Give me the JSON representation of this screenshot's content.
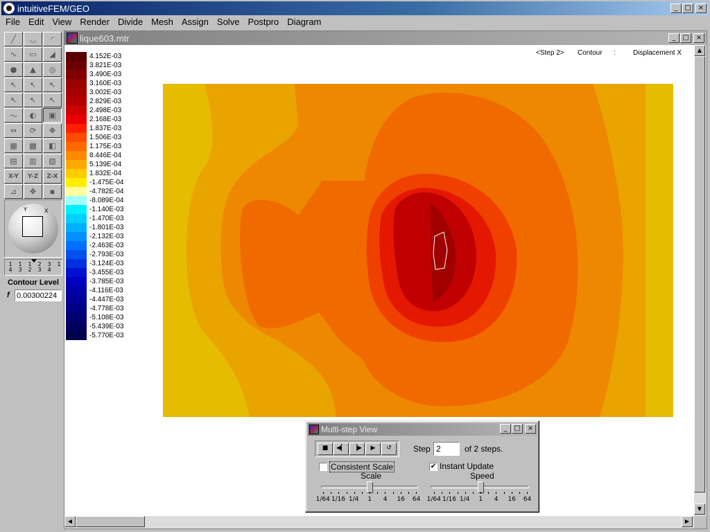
{
  "app": {
    "title": "intuitiveFEM/GEO",
    "menu": [
      "File",
      "Edit",
      "View",
      "Render",
      "Divide",
      "Mesh",
      "Assign",
      "Solve",
      "Postpro",
      "Diagram"
    ]
  },
  "window_buttons": {
    "minimize": "_",
    "maximize": "□",
    "close": "×"
  },
  "toolbar": {
    "tools": [
      {
        "icon": "line-icon",
        "glyph": "╱"
      },
      {
        "icon": "arc-icon",
        "glyph": "◡"
      },
      {
        "icon": "arc3-icon",
        "glyph": "◜"
      },
      {
        "icon": "spline-icon",
        "glyph": "∿"
      },
      {
        "icon": "rectangle-icon",
        "glyph": "▭"
      },
      {
        "icon": "surface-icon",
        "glyph": "◢"
      },
      {
        "icon": "circle-solid-icon",
        "glyph": "●"
      },
      {
        "icon": "cone-icon",
        "glyph": "▲"
      },
      {
        "icon": "torus-icon",
        "glyph": "◎"
      },
      {
        "icon": "select-icon",
        "glyph": "↖"
      },
      {
        "icon": "select-edge-icon",
        "glyph": "↖"
      },
      {
        "icon": "select-face-icon",
        "glyph": "↖"
      },
      {
        "icon": "select-node-icon",
        "glyph": "↖"
      },
      {
        "icon": "select-element-icon",
        "glyph": "↖"
      },
      {
        "icon": "select-volume-icon",
        "glyph": "↖"
      },
      {
        "icon": "curve-icon",
        "glyph": "〜"
      },
      {
        "icon": "sweep-icon",
        "glyph": "◐"
      },
      {
        "icon": "pick-display-icon",
        "glyph": "▣"
      },
      {
        "icon": "move-icon",
        "glyph": "⇔"
      },
      {
        "icon": "rotate-icon",
        "glyph": "⟳"
      },
      {
        "icon": "pan-icon",
        "glyph": "✥"
      },
      {
        "icon": "box-wire-icon",
        "glyph": "▦"
      },
      {
        "icon": "box-solid-icon",
        "glyph": "▩"
      },
      {
        "icon": "box-shaded-icon",
        "glyph": "◧"
      },
      {
        "icon": "mesh-icon",
        "glyph": "▤"
      },
      {
        "icon": "mesh-fill-icon",
        "glyph": "▥"
      },
      {
        "icon": "mesh-outline-icon",
        "glyph": "▧"
      },
      {
        "label": "X-Y"
      },
      {
        "label": "Y-Z"
      },
      {
        "label": "Z-X"
      },
      {
        "icon": "axis-view-icon",
        "glyph": "⊿"
      },
      {
        "icon": "fit-view-icon",
        "glyph": "✥"
      },
      {
        "icon": "point-icon",
        "glyph": "▪"
      }
    ],
    "view_sphere": {
      "x_axis": "X",
      "y_axis": "Y"
    },
    "level_ruler": [
      {
        "num": "1",
        "den": "4"
      },
      {
        "num": "1",
        "den": "3"
      },
      {
        "num": "1",
        "den": "2"
      },
      {
        "num": "2",
        "den": "3"
      },
      {
        "num": "3",
        "den": "4"
      },
      {
        "num": "1",
        "den": ""
      }
    ],
    "contour_level": {
      "title": "Contour Level",
      "f_label": "f",
      "value": "0.00300224"
    }
  },
  "document": {
    "title": "lique603.mtr",
    "status": {
      "step": "<Step 2>",
      "mode": "Contour",
      "sep": ":",
      "quantity": "Displacement X"
    }
  },
  "legend": [
    {
      "value": "4.152E-03",
      "color": "#5a0000"
    },
    {
      "value": "3.821E-03",
      "color": "#6c0000"
    },
    {
      "value": "3.490E-03",
      "color": "#820000"
    },
    {
      "value": "3.160E-03",
      "color": "#980000"
    },
    {
      "value": "3.002E-03",
      "color": "#a60000"
    },
    {
      "value": "2.829E-03",
      "color": "#b40000"
    },
    {
      "value": "2.498E-03",
      "color": "#d00000"
    },
    {
      "value": "2.168E-03",
      "color": "#ea0000"
    },
    {
      "value": "1.837E-03",
      "color": "#ff2000"
    },
    {
      "value": "1.506E-03",
      "color": "#ff4a00"
    },
    {
      "value": "1.175E-03",
      "color": "#ff6a00"
    },
    {
      "value": "8.446E-04",
      "color": "#ff8a00"
    },
    {
      "value": "5.139E-04",
      "color": "#ffaa00"
    },
    {
      "value": "1.832E-04",
      "color": "#ffcc00"
    },
    {
      "value": "-1.475E-04",
      "color": "#ffee00"
    },
    {
      "value": "-4.782E-04",
      "color": "#ffffa0"
    },
    {
      "value": "-8.089E-04",
      "color": "#a0ffff"
    },
    {
      "value": "-1.140E-03",
      "color": "#00f0ff"
    },
    {
      "value": "-1.470E-03",
      "color": "#00d0ff"
    },
    {
      "value": "-1.801E-03",
      "color": "#00b0ff"
    },
    {
      "value": "-2.132E-03",
      "color": "#0090ff"
    },
    {
      "value": "-2.463E-03",
      "color": "#0070ff"
    },
    {
      "value": "-2.793E-03",
      "color": "#0050f0"
    },
    {
      "value": "-3.124E-03",
      "color": "#0030e0"
    },
    {
      "value": "-3.455E-03",
      "color": "#0010d0"
    },
    {
      "value": "-3.785E-03",
      "color": "#0000c0"
    },
    {
      "value": "-4.116E-03",
      "color": "#0000a8"
    },
    {
      "value": "-4.447E-03",
      "color": "#000096"
    },
    {
      "value": "-4.778E-03",
      "color": "#000084"
    },
    {
      "value": "-5.108E-03",
      "color": "#000070"
    },
    {
      "value": "-5.439E-03",
      "color": "#00005e"
    },
    {
      "value": "-5.770E-03",
      "color": "#00004a"
    }
  ],
  "plot_colors": {
    "band1": "#e6bc00",
    "band2": "#eaa400",
    "band3": "#ee8800",
    "band4": "#f06a00",
    "band5": "#f04000",
    "band6": "#e41800",
    "band7": "#c00000",
    "band8": "#a00000",
    "outline": "#ffffff"
  },
  "dialog": {
    "title": "Multi-step View",
    "player": [
      {
        "icon": "stop-icon",
        "glyph": "■"
      },
      {
        "icon": "step-back-icon",
        "glyph": "◀▏"
      },
      {
        "icon": "step-forward-icon",
        "glyph": "▕▶"
      },
      {
        "icon": "play-icon",
        "glyph": "▶"
      },
      {
        "icon": "loop-icon",
        "glyph": "↺"
      }
    ],
    "step_label": "Step",
    "step_value": "2",
    "steps_total": "of 2 steps.",
    "consistent_scale": {
      "label": "Consistent Scale",
      "checked": false
    },
    "instant_update": {
      "label": "Instant Update",
      "checked": true,
      "mark": "✔"
    },
    "scale": {
      "title": "Scale",
      "ticks": [
        "1/64",
        "1/16",
        "1/4",
        "1",
        "4",
        "16",
        "64"
      ],
      "value": "1"
    },
    "speed": {
      "title": "Speed",
      "ticks": [
        "1/64",
        "1/16",
        "1/4",
        "1",
        "4",
        "16",
        "64"
      ],
      "value": "1"
    }
  },
  "scrollbars": {
    "up": "▲",
    "down": "▼",
    "left": "◀",
    "right": "▶"
  }
}
